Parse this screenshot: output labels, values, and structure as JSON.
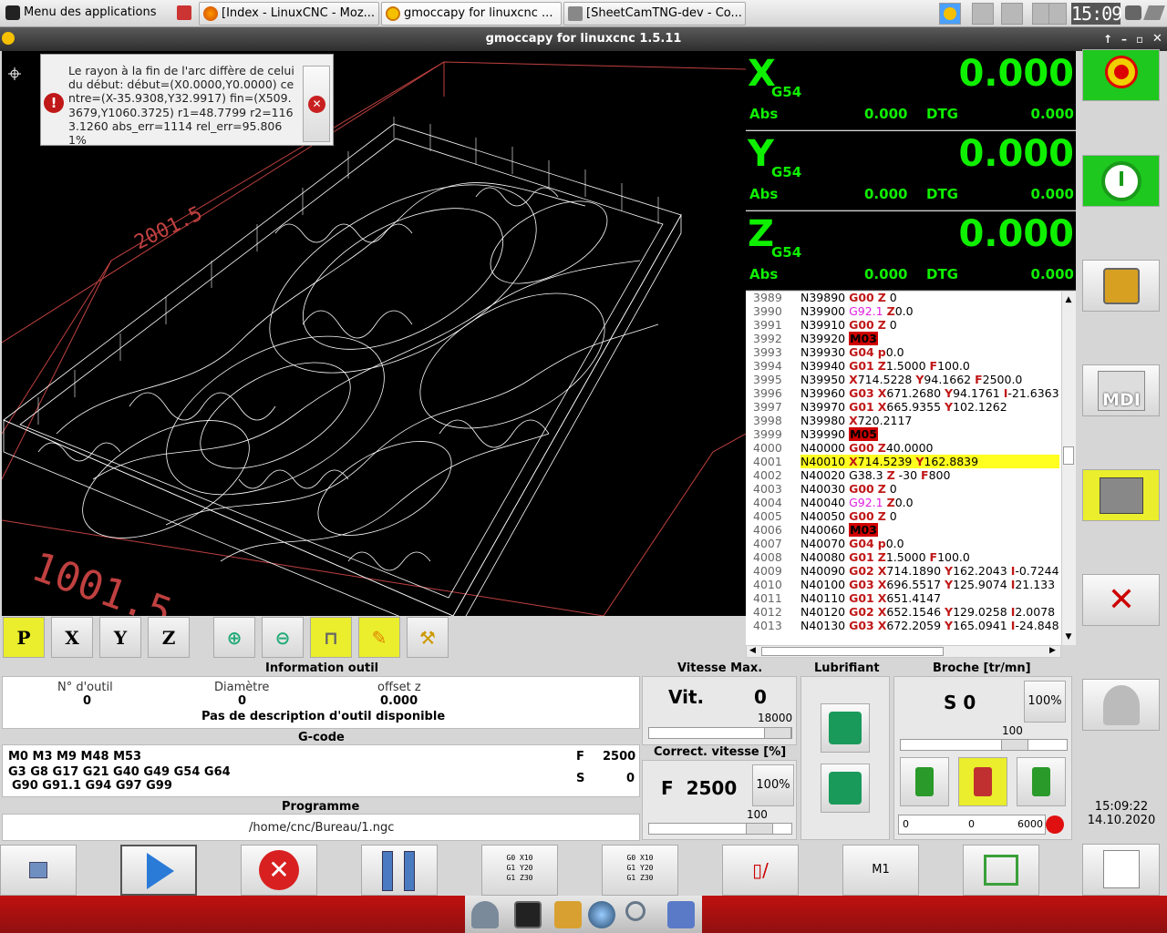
{
  "taskbar": {
    "menu_label": "Menu des applications",
    "windows": [
      {
        "label": "[Index - LinuxCNC - Moz..."
      },
      {
        "label": "gmoccapy for linuxcnc  ..."
      },
      {
        "label": "[SheetCamTNG-dev - Co..."
      }
    ],
    "clock": "15:09"
  },
  "window": {
    "title": "gmoccapy for linuxcnc  1.5.11"
  },
  "error": {
    "message": "Le rayon à la fin de l'arc diffère de celui du début: début=(X0.0000,Y0.0000) centre=(X-35.9308,Y32.9917) fin=(X509.3679,Y1060.3725) r1=48.7799 r2=1163.1260 abs_err=1114 rel_err=95.8061%",
    "icon": "error-icon",
    "close_icon": "close-icon"
  },
  "preview": {
    "dim_long": "2001.5",
    "dim_short": "1001.5"
  },
  "view_buttons": [
    {
      "label": "P",
      "icon": "perspective-view-icon"
    },
    {
      "label": "X",
      "icon": "x-view-icon"
    },
    {
      "label": "Y",
      "icon": "y-view-icon"
    },
    {
      "label": "Z",
      "icon": "z-view-icon"
    }
  ],
  "dro": [
    {
      "axis": "X",
      "system": "G54",
      "value": "0.000",
      "abs_label": "Abs",
      "abs_value": "0.000",
      "dtg_label": "DTG",
      "dtg_value": "0.000"
    },
    {
      "axis": "Y",
      "system": "G54",
      "value": "0.000",
      "abs_label": "Abs",
      "abs_value": "0.000",
      "dtg_label": "DTG",
      "dtg_value": "0.000"
    },
    {
      "axis": "Z",
      "system": "G54",
      "value": "0.000",
      "abs_label": "Abs",
      "abs_value": "0.000",
      "dtg_label": "DTG",
      "dtg_value": "0.000"
    }
  ],
  "gcode_lines": [
    {
      "n": "3989",
      "t": [
        [
          "N39890 ",
          ""
        ],
        [
          "G00",
          "r"
        ],
        [
          " ",
          ""
        ],
        [
          "Z",
          "r"
        ],
        [
          " 0",
          ""
        ]
      ]
    },
    {
      "n": "3990",
      "t": [
        [
          "N39900 ",
          ""
        ],
        [
          "G92.1",
          "m"
        ],
        [
          " ",
          ""
        ],
        [
          "Z",
          "r"
        ],
        [
          "0.0",
          ""
        ]
      ]
    },
    {
      "n": "3991",
      "t": [
        [
          "N39910 ",
          ""
        ],
        [
          "G00",
          "r"
        ],
        [
          " ",
          ""
        ],
        [
          "Z",
          "r"
        ],
        [
          " 0",
          ""
        ]
      ]
    },
    {
      "n": "3992",
      "t": [
        [
          "N39920 ",
          ""
        ],
        [
          "M03",
          "bm"
        ]
      ]
    },
    {
      "n": "3993",
      "t": [
        [
          "N39930 ",
          ""
        ],
        [
          "G04",
          "r"
        ],
        [
          " ",
          ""
        ],
        [
          "p",
          "r"
        ],
        [
          "0.0",
          ""
        ]
      ]
    },
    {
      "n": "3994",
      "t": [
        [
          "N39940 ",
          ""
        ],
        [
          "G01",
          "r"
        ],
        [
          " ",
          ""
        ],
        [
          "Z",
          "r"
        ],
        [
          "1.5000 ",
          ""
        ],
        [
          "F",
          "r"
        ],
        [
          "100.0",
          ""
        ]
      ]
    },
    {
      "n": "3995",
      "t": [
        [
          "N39950 ",
          ""
        ],
        [
          "X",
          "r"
        ],
        [
          "714.5228 ",
          ""
        ],
        [
          "Y",
          "r"
        ],
        [
          "94.1662 ",
          ""
        ],
        [
          "F",
          "r"
        ],
        [
          "2500.0",
          ""
        ]
      ]
    },
    {
      "n": "3996",
      "t": [
        [
          "N39960 ",
          ""
        ],
        [
          "G03",
          "r"
        ],
        [
          " ",
          ""
        ],
        [
          "X",
          "r"
        ],
        [
          "671.2680 ",
          ""
        ],
        [
          "Y",
          "r"
        ],
        [
          "94.1761 ",
          ""
        ],
        [
          "I",
          "r"
        ],
        [
          "-21.6363",
          ""
        ]
      ]
    },
    {
      "n": "3997",
      "t": [
        [
          "N39970 ",
          ""
        ],
        [
          "G01",
          "r"
        ],
        [
          " ",
          ""
        ],
        [
          "X",
          "r"
        ],
        [
          "665.9355 ",
          ""
        ],
        [
          "Y",
          "r"
        ],
        [
          "102.1262",
          ""
        ]
      ]
    },
    {
      "n": "3998",
      "t": [
        [
          "N39980 ",
          ""
        ],
        [
          "X",
          "r"
        ],
        [
          "720.2117",
          ""
        ]
      ]
    },
    {
      "n": "3999",
      "t": [
        [
          "N39990 ",
          ""
        ],
        [
          "M05",
          "bm"
        ]
      ]
    },
    {
      "n": "4000",
      "t": [
        [
          "N40000 ",
          ""
        ],
        [
          "G00",
          "r"
        ],
        [
          " ",
          ""
        ],
        [
          "Z",
          "r"
        ],
        [
          "40.0000",
          ""
        ]
      ]
    },
    {
      "n": "4001",
      "t": [
        [
          "N40010 ",
          ""
        ],
        [
          "X",
          "r"
        ],
        [
          "714.5239 ",
          ""
        ],
        [
          "Y",
          "r"
        ],
        [
          "162.8839",
          ""
        ]
      ],
      "hl": true
    },
    {
      "n": "4002",
      "t": [
        [
          "N40020 G38.3 ",
          ""
        ],
        [
          "Z",
          "r"
        ],
        [
          " -30 ",
          ""
        ],
        [
          "F",
          "r"
        ],
        [
          "800",
          ""
        ]
      ]
    },
    {
      "n": "4003",
      "t": [
        [
          "N40030 ",
          ""
        ],
        [
          "G00",
          "r"
        ],
        [
          " ",
          ""
        ],
        [
          "Z",
          "r"
        ],
        [
          " 0",
          ""
        ]
      ]
    },
    {
      "n": "4004",
      "t": [
        [
          "N40040 ",
          ""
        ],
        [
          "G92.1",
          "m"
        ],
        [
          " ",
          ""
        ],
        [
          "Z",
          "r"
        ],
        [
          "0.0",
          ""
        ]
      ]
    },
    {
      "n": "4005",
      "t": [
        [
          "N40050 ",
          ""
        ],
        [
          "G00",
          "r"
        ],
        [
          " ",
          ""
        ],
        [
          "Z",
          "r"
        ],
        [
          " 0",
          ""
        ]
      ]
    },
    {
      "n": "4006",
      "t": [
        [
          "N40060 ",
          ""
        ],
        [
          "M03",
          "bm"
        ]
      ]
    },
    {
      "n": "4007",
      "t": [
        [
          "N40070 ",
          ""
        ],
        [
          "G04",
          "r"
        ],
        [
          " ",
          ""
        ],
        [
          "p",
          "r"
        ],
        [
          "0.0",
          ""
        ]
      ]
    },
    {
      "n": "4008",
      "t": [
        [
          "N40080 ",
          ""
        ],
        [
          "G01",
          "r"
        ],
        [
          " ",
          ""
        ],
        [
          "Z",
          "r"
        ],
        [
          "1.5000 ",
          ""
        ],
        [
          "F",
          "r"
        ],
        [
          "100.0",
          ""
        ]
      ]
    },
    {
      "n": "4009",
      "t": [
        [
          "N40090 ",
          ""
        ],
        [
          "G02",
          "r"
        ],
        [
          " ",
          ""
        ],
        [
          "X",
          "r"
        ],
        [
          "714.1890 ",
          ""
        ],
        [
          "Y",
          "r"
        ],
        [
          "162.2043 ",
          ""
        ],
        [
          "I",
          "r"
        ],
        [
          "-0.7244",
          ""
        ]
      ]
    },
    {
      "n": "4010",
      "t": [
        [
          "N40100 ",
          ""
        ],
        [
          "G03",
          "r"
        ],
        [
          " ",
          ""
        ],
        [
          "X",
          "r"
        ],
        [
          "696.5517 ",
          ""
        ],
        [
          "Y",
          "r"
        ],
        [
          "125.9074 ",
          ""
        ],
        [
          "I",
          "r"
        ],
        [
          "21.133",
          ""
        ]
      ]
    },
    {
      "n": "4011",
      "t": [
        [
          "N40110 ",
          ""
        ],
        [
          "G01",
          "r"
        ],
        [
          " ",
          ""
        ],
        [
          "X",
          "r"
        ],
        [
          "651.4147",
          ""
        ]
      ]
    },
    {
      "n": "4012",
      "t": [
        [
          "N40120 ",
          ""
        ],
        [
          "G02",
          "r"
        ],
        [
          " ",
          ""
        ],
        [
          "X",
          "r"
        ],
        [
          "652.1546 ",
          ""
        ],
        [
          "Y",
          "r"
        ],
        [
          "129.0258 ",
          ""
        ],
        [
          "I",
          "r"
        ],
        [
          "2.0078",
          ""
        ]
      ]
    },
    {
      "n": "4013",
      "t": [
        [
          "N40130 ",
          ""
        ],
        [
          "G03",
          "r"
        ],
        [
          " ",
          ""
        ],
        [
          "X",
          "r"
        ],
        [
          "672.2059 ",
          ""
        ],
        [
          "Y",
          "r"
        ],
        [
          "165.0941 ",
          ""
        ],
        [
          "I",
          "r"
        ],
        [
          "-24.848",
          ""
        ]
      ]
    }
  ],
  "tool_info": {
    "title": "Information outil",
    "tool_no_label": "N° d'outil",
    "tool_no": "0",
    "diameter_label": "Diamètre",
    "diameter": "0",
    "offset_label": "offset z",
    "offset": "0.000",
    "description": "Pas de description d'outil disponible"
  },
  "gcode_info": {
    "title": "G-code",
    "line1": "M0 M3 M9 M48 M53",
    "line2": "G3 G8 G17 G21 G40 G49 G54 G64",
    "line3": "G90 G91.1 G94 G97 G99",
    "f_label": "F",
    "f_value": "2500",
    "s_label": "S",
    "s_value": "0"
  },
  "program": {
    "title": "Programme",
    "path": "/home/cnc/Bureau/1.ngc"
  },
  "max_velocity": {
    "title": "Vitesse Max.",
    "label": "Vit.",
    "value": "0",
    "max": "18000"
  },
  "feed_override": {
    "title": "Correct. vitesse [%]",
    "label": "F  2500",
    "button": "100%",
    "scale": "100"
  },
  "coolant": {
    "title": "Lubrifiant"
  },
  "spindle": {
    "title": "Broche [tr/mn]",
    "value": "S 0",
    "button": "100%",
    "scale": "100",
    "bar_min": "0",
    "bar_value": "0",
    "bar_max": "6000"
  },
  "datetime": {
    "time": "15:09:22",
    "date": "14.10.2020"
  },
  "bottom_buttons": {
    "m1": "M1"
  },
  "right_buttons": {
    "mdi": "MDI"
  }
}
